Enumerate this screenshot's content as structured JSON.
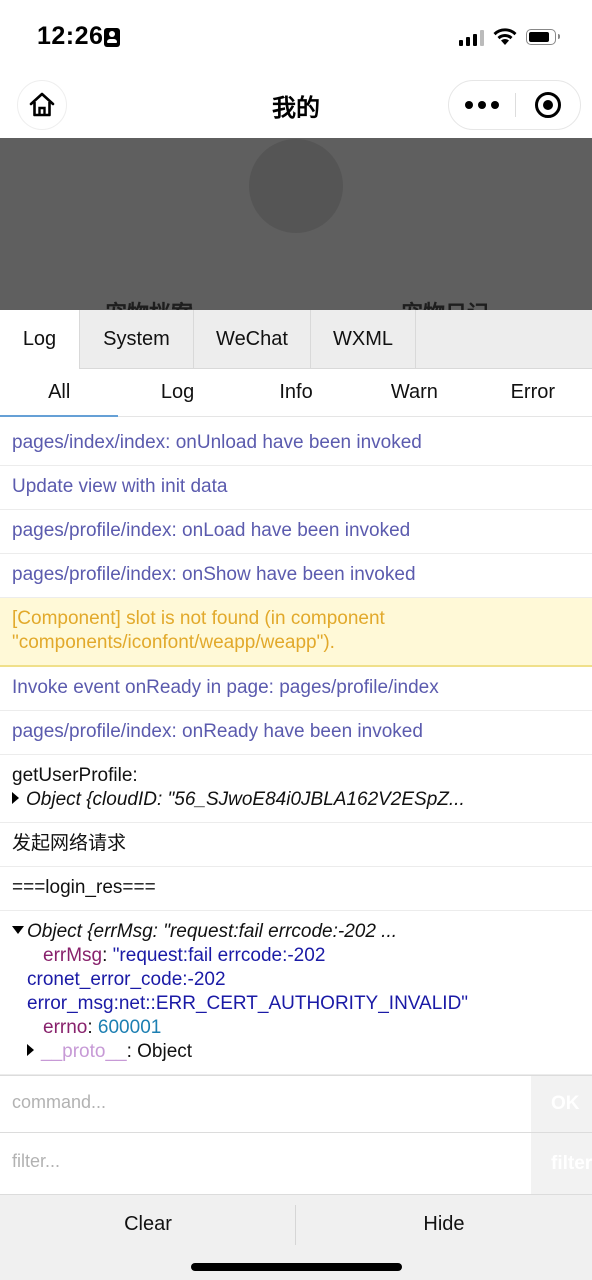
{
  "status_bar": {
    "time": "12:26"
  },
  "nav": {
    "title": "我的"
  },
  "background_page": {
    "label_left": "宠物档案",
    "label_right": "宠物日记"
  },
  "vconsole": {
    "tabs": [
      "Log",
      "System",
      "WeChat",
      "WXML"
    ],
    "active_tab": "Log",
    "sub_tabs": [
      "All",
      "Log",
      "Info",
      "Warn",
      "Error"
    ],
    "active_sub_tab": "All",
    "logs": {
      "l1": "pages/index/index: onUnload have been invoked",
      "l2": "Update view with init data",
      "l3": "pages/profile/index: onLoad have been invoked",
      "l4": "pages/profile/index: onShow have been invoked",
      "warn1": "[Component] slot is not found (in component",
      "warn2": "\"components/iconfont/weapp/weapp\").",
      "l5": "Invoke event onReady in page: pages/profile/index",
      "l6": "pages/profile/index: onReady have been invoked",
      "l7_label": "getUserProfile:",
      "l7_obj": "Object {cloudID: \"56_SJwoE84i0JBLA162V2ESpZ...",
      "l8": "发起网络请求",
      "l9": "===login_res===",
      "l10_obj": "Object {errMsg: \"request:fail errcode:-202 ...",
      "errmsg_key": "errMsg",
      "errmsg_val1": "\"request:fail errcode:-202",
      "errmsg_val2": "cronet_error_code:-202",
      "errmsg_val3": "error_msg:net::ERR_CERT_AUTHORITY_INVALID\"",
      "errno_key": "errno",
      "errno_val": "600001",
      "proto_key": "__proto__",
      "proto_val": "Object"
    },
    "command_placeholder": "command...",
    "command_button": "OK",
    "filter_placeholder": "filter...",
    "filter_button": "filter",
    "footer": {
      "clear": "Clear",
      "hide": "Hide"
    }
  }
}
